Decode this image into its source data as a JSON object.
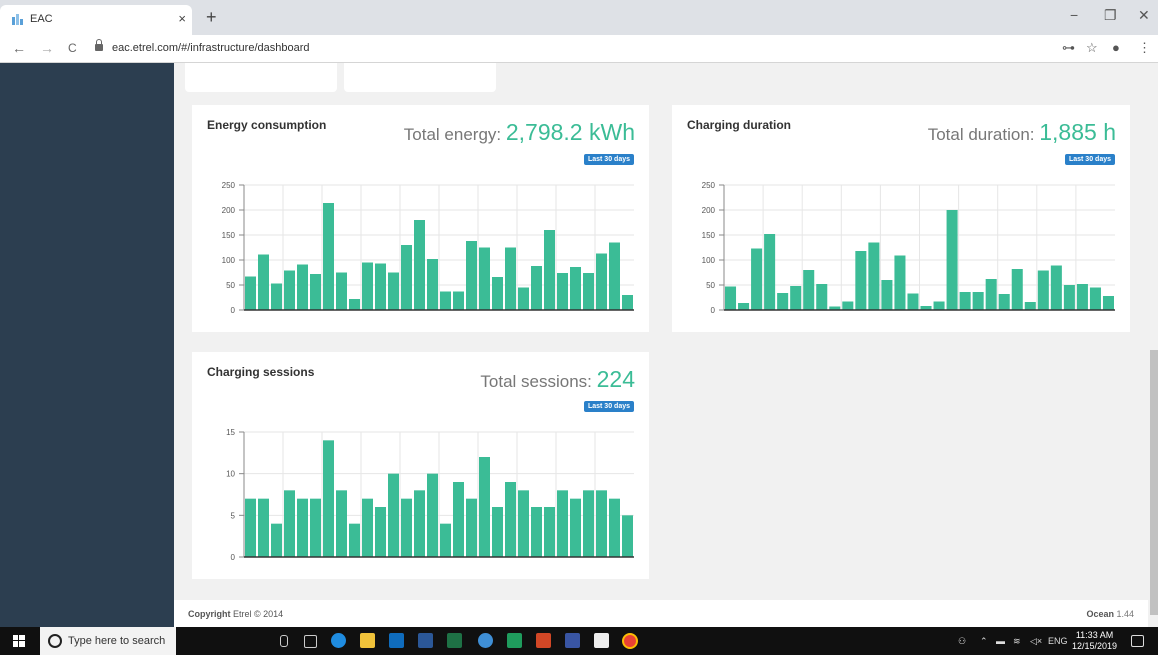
{
  "browser": {
    "tab_title": "EAC",
    "url": "eac.etrel.com/#/infrastructure/dashboard",
    "tab_close": "×",
    "new_tab": "+",
    "min": "−",
    "max": "❐",
    "close": "✕",
    "back": "←",
    "forward": "→",
    "reload": "C",
    "key": "⊶",
    "star": "☆",
    "profile": "●",
    "menu": "⋮"
  },
  "cards": {
    "energy": {
      "title": "Energy consumption",
      "total_label": "Total energy:",
      "total_value": "2,798.2 kWh",
      "badge": "Last 30 days"
    },
    "duration": {
      "title": "Charging duration",
      "total_label": "Total duration:",
      "total_value": "1,885 h",
      "badge": "Last 30 days"
    },
    "sessions": {
      "title": "Charging sessions",
      "total_label": "Total sessions:",
      "total_value": "224",
      "badge": "Last 30 days"
    }
  },
  "footer": {
    "copyright_bold": "Copyright",
    "copyright_rest": "Etrel © 2014",
    "version_bold": "Ocean",
    "version_rest": "1.44"
  },
  "taskbar": {
    "search_placeholder": "Type here to search",
    "time": "11:33 AM",
    "date": "12/15/2019",
    "lang": "ENG"
  },
  "colors": {
    "bar": "#3bbc96",
    "accent": "#2a80c9",
    "sidebar": "#2c3e50"
  },
  "chart_data": [
    {
      "type": "bar",
      "title": "Energy consumption",
      "ylim": [
        0,
        250
      ],
      "yticks": [
        0,
        50,
        100,
        150,
        200,
        250
      ],
      "grid": true,
      "values": [
        67,
        111,
        53,
        79,
        91,
        72,
        214,
        75,
        22,
        95,
        93,
        75,
        130,
        180,
        102,
        37,
        37,
        138,
        125,
        66,
        125,
        45,
        88,
        160,
        74,
        86,
        74,
        113,
        135,
        30
      ]
    },
    {
      "type": "bar",
      "title": "Charging duration",
      "ylim": [
        0,
        250
      ],
      "yticks": [
        0,
        50,
        100,
        150,
        200,
        250
      ],
      "grid": true,
      "values": [
        47,
        14,
        123,
        152,
        34,
        48,
        80,
        52,
        7,
        17,
        118,
        135,
        60,
        109,
        33,
        8,
        17,
        200,
        36,
        36,
        62,
        32,
        82,
        16,
        79,
        89,
        50,
        52,
        45,
        28
      ]
    },
    {
      "type": "bar",
      "title": "Charging sessions",
      "ylim": [
        0,
        15
      ],
      "yticks": [
        0,
        5,
        10,
        15
      ],
      "grid": true,
      "values": [
        7,
        7,
        4,
        8,
        7,
        7,
        14,
        8,
        4,
        7,
        6,
        10,
        7,
        8,
        10,
        4,
        9,
        7,
        12,
        6,
        9,
        8,
        6,
        6,
        8,
        7,
        8,
        8,
        7,
        5
      ]
    }
  ]
}
